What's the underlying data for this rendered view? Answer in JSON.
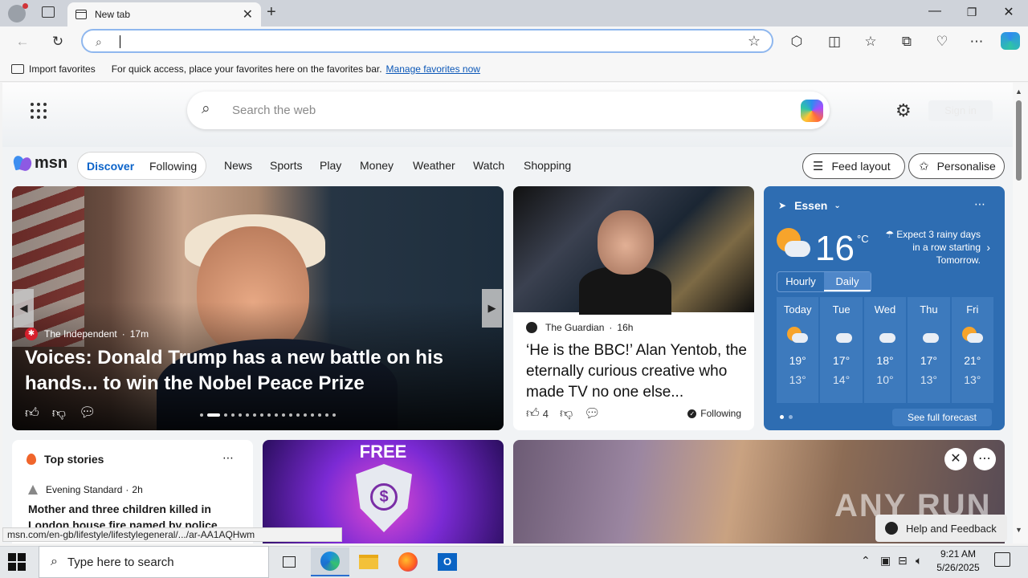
{
  "browser": {
    "tab_title": "New tab",
    "address_value": "",
    "favbar_import": "Import favorites",
    "favbar_message": "For quick access, place your favorites here on the favorites bar.",
    "favbar_link": "Manage favorites now"
  },
  "msn": {
    "search_placeholder": "Search the web",
    "signin": "Sign in",
    "logo_text": "msn",
    "feed_tabs": [
      "Discover",
      "Following"
    ],
    "nav": [
      "News",
      "Sports",
      "Play",
      "Money",
      "Weather",
      "Watch",
      "Shopping"
    ],
    "feed_layout": "Feed layout",
    "personalise": "Personalise"
  },
  "hero": {
    "source": "The Independent",
    "time": "17m",
    "headline": "Voices: Donald Trump has a new battle on his hands... to win the Nobel Peace Prize",
    "slide_count": 18,
    "active_slide": 2
  },
  "card2": {
    "source": "The Guardian",
    "time": "16h",
    "headline": "‘He is the BBC!’ Alan Yentob, the eternally curious creative who made TV no one else...",
    "likes": "4",
    "following": "Following"
  },
  "weather": {
    "location": "Essen",
    "temp": "16",
    "unit": "°C",
    "forecast_note": "Expect 3 rainy days in a row starting Tomorrow.",
    "toggle": [
      "Hourly",
      "Daily"
    ],
    "days": [
      {
        "name": "Today",
        "hi": "19°",
        "lo": "13°",
        "icon": "sun-cloud"
      },
      {
        "name": "Tue",
        "hi": "17°",
        "lo": "14°",
        "icon": "rain-cloud"
      },
      {
        "name": "Wed",
        "hi": "18°",
        "lo": "10°",
        "icon": "rain-cloud"
      },
      {
        "name": "Thu",
        "hi": "17°",
        "lo": "13°",
        "icon": "rain-cloud"
      },
      {
        "name": "Fri",
        "hi": "21°",
        "lo": "13°",
        "icon": "sun-cloud"
      }
    ],
    "see_full": "See full forecast"
  },
  "topstories": {
    "title": "Top stories",
    "source": "Evening Standard",
    "time": "2h",
    "headline": "Mother and three children killed in London house fire named by police"
  },
  "ad1": {
    "label": "FREE"
  },
  "ad2": {
    "watermark": "ANY RUN"
  },
  "status_url": "msn.com/en-gb/lifestyle/lifestylegeneral/.../ar-AA1AQHwm",
  "help": "Help and Feedback",
  "taskbar": {
    "search_placeholder": "Type here to search",
    "time": "9:21 AM",
    "date": "5/26/2025"
  }
}
